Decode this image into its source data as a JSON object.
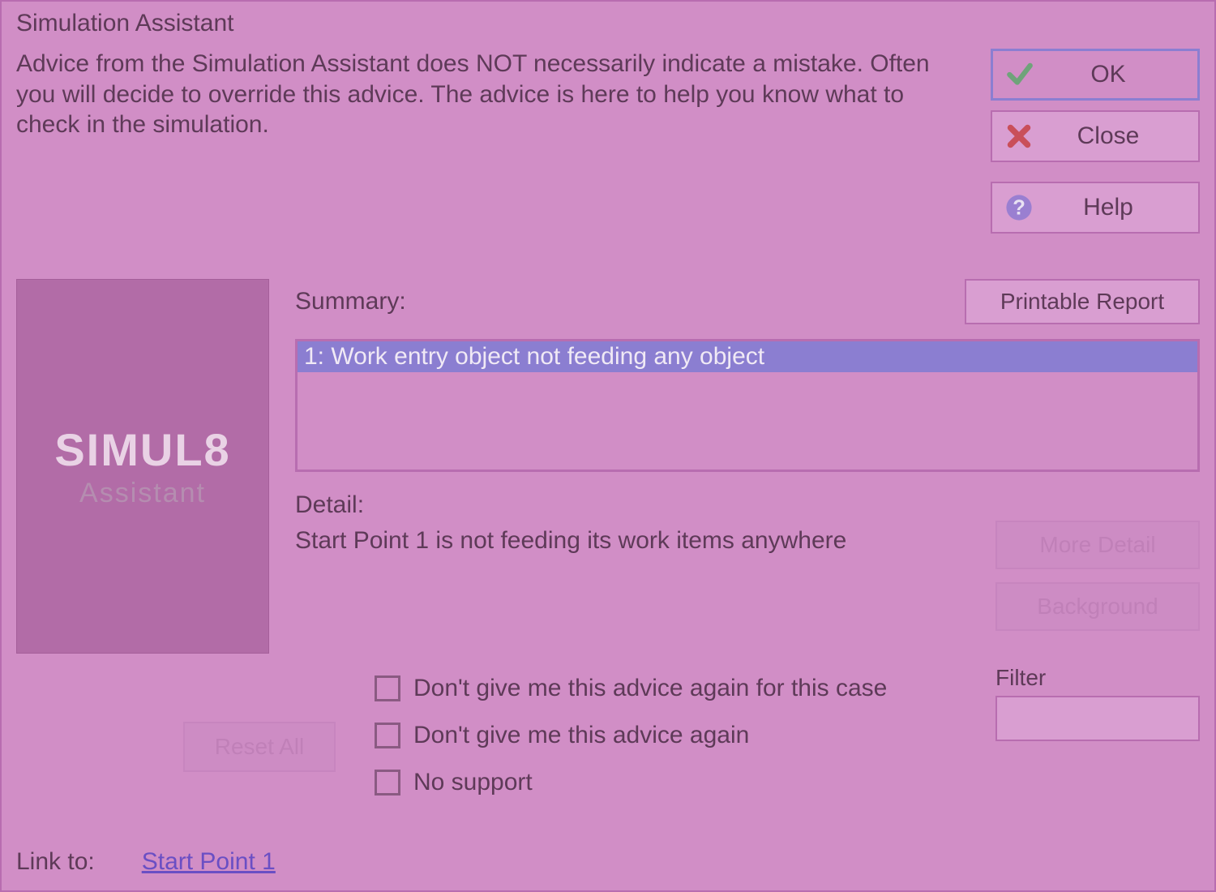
{
  "window": {
    "title": "Simulation Assistant"
  },
  "advice": "Advice from the Simulation Assistant does NOT necessarily indicate a mistake.  Often you will decide to override this advice.  The advice is here to help you know what to check in the simulation.",
  "buttons": {
    "ok": "OK",
    "close": "Close",
    "help": "Help",
    "printable": "Printable Report",
    "more_detail": "More Detail",
    "background": "Background",
    "reset_all": "Reset All"
  },
  "logo": {
    "title": "SIMUL8",
    "sub": "Assistant"
  },
  "labels": {
    "summary": "Summary:",
    "detail": "Detail:",
    "filter": "Filter",
    "link_to": "Link to:"
  },
  "summary_items": [
    "1: Work entry object not feeding any object"
  ],
  "detail_text": "Start Point 1 is not feeding its work items anywhere",
  "filter_value": "",
  "checkboxes": {
    "c1": "Don't give me this advice again for this case",
    "c2": "Don't give me this advice again",
    "c3": "No support"
  },
  "link_target": "Start Point 1"
}
